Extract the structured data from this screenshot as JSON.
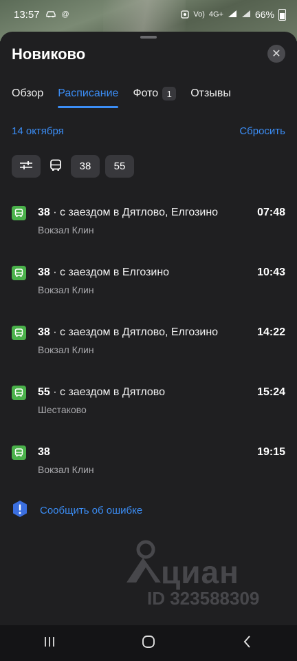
{
  "status_bar": {
    "time": "13:57",
    "battery": "66%",
    "network": "4G+"
  },
  "sheet": {
    "title": "Новиково",
    "close_glyph": "✕",
    "tabs": [
      {
        "label": "Обзор",
        "active": false
      },
      {
        "label": "Расписание",
        "active": true
      },
      {
        "label": "Фото",
        "badge": "1",
        "active": false
      },
      {
        "label": "Отзывы",
        "active": false
      }
    ],
    "date": "14 октября",
    "reset_label": "Сбросить",
    "filters": {
      "routes": [
        "38",
        "55"
      ]
    },
    "routes": [
      {
        "number": "38",
        "via": " · с заездом в Дятлово, Елгозино",
        "stop": "Вокзал Клин",
        "time": "07:48"
      },
      {
        "number": "38",
        "via": " · с заездом в Елгозино",
        "stop": "Вокзал Клин",
        "time": "10:43"
      },
      {
        "number": "38",
        "via": " · с заездом в Дятлово, Елгозино",
        "stop": "Вокзал Клин",
        "time": "14:22"
      },
      {
        "number": "55",
        "via": " · с заездом в Дятлово",
        "stop": "Шестаково",
        "time": "15:24"
      },
      {
        "number": "38",
        "via": "",
        "stop": "Вокзал Клин",
        "time": "19:15"
      }
    ],
    "report_label": "Сообщить об ошибке"
  },
  "watermark": {
    "brand": "циан",
    "id_text": "ID 323588309"
  },
  "colors": {
    "accent": "#3b8df5",
    "bus_badge": "#4ab14a",
    "sheet_bg": "#1f1f21",
    "chip_bg": "#38383c"
  }
}
